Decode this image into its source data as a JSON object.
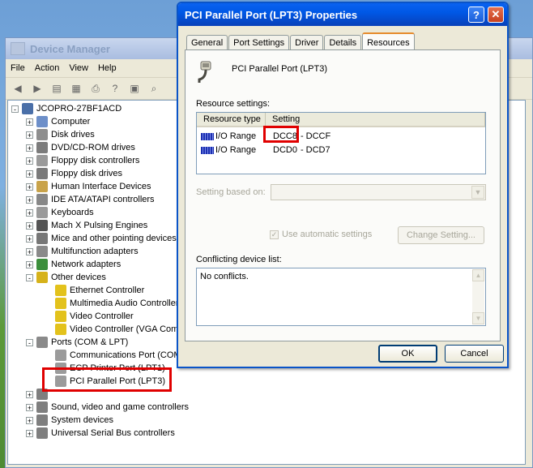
{
  "device_manager": {
    "title": "Device Manager",
    "menu": [
      "File",
      "Action",
      "View",
      "Help"
    ],
    "toolbar_icons": [
      "back-arrow-icon",
      "forward-arrow-icon",
      "show-hide-tree-icon",
      "properties-icon",
      "print-icon",
      "help-icon",
      "view-icon",
      "scan-icon"
    ],
    "tree": {
      "root": "JCOPRO-27BF1ACD",
      "categories": [
        {
          "label": "Computer",
          "expander": "+"
        },
        {
          "label": "Disk drives",
          "expander": "+"
        },
        {
          "label": "DVD/CD-ROM drives",
          "expander": "+"
        },
        {
          "label": "Floppy disk controllers",
          "expander": "+"
        },
        {
          "label": "Floppy disk drives",
          "expander": "+"
        },
        {
          "label": "Human Interface Devices",
          "expander": "+"
        },
        {
          "label": "IDE ATA/ATAPI controllers",
          "expander": "+"
        },
        {
          "label": "Keyboards",
          "expander": "+"
        },
        {
          "label": "Mach X Pulsing Engines",
          "expander": "+"
        },
        {
          "label": "Mice and other pointing devices",
          "expander": "+"
        },
        {
          "label": "Multifunction adapters",
          "expander": "+"
        },
        {
          "label": "Network adapters",
          "expander": "+"
        },
        {
          "label": "Other devices",
          "expander": "-"
        }
      ],
      "other_devices": [
        "Ethernet Controller",
        "Multimedia Audio Controller",
        "Video Controller",
        "Video Controller (VGA Comp"
      ],
      "ports_label": "Ports (COM & LPT)",
      "ports_expander": "-",
      "ports": [
        "Communications Port (COM",
        "ECP Printer Port (LPT1)",
        "PCI Parallel Port (LPT3)"
      ],
      "tail_categories": [
        {
          "label": "",
          "expander": "+"
        },
        {
          "label": "Sound, video and game controllers",
          "expander": "+"
        },
        {
          "label": "System devices",
          "expander": "+"
        },
        {
          "label": "Universal Serial Bus controllers",
          "expander": "+"
        }
      ]
    }
  },
  "dialog": {
    "title": "PCI Parallel Port (LPT3) Properties",
    "help_glyph": "?",
    "close_glyph": "✕",
    "tabs": [
      "General",
      "Port Settings",
      "Driver",
      "Details",
      "Resources"
    ],
    "active_tab": "Resources",
    "device_name": "PCI Parallel Port (LPT3)",
    "resource_settings_label": "Resource settings:",
    "columns": [
      "Resource type",
      "Setting"
    ],
    "resources": [
      {
        "type": "I/O Range",
        "setting_start": "DCC8",
        "setting_rest": "- DCCF"
      },
      {
        "type": "I/O Range",
        "setting_start": "DCD0",
        "setting_rest": "- DCD7"
      }
    ],
    "setting_based_on_label": "Setting based on:",
    "use_automatic_label": "Use automatic settings",
    "use_automatic_checked": true,
    "change_setting_label": "Change Setting...",
    "conflict_label": "Conflicting device list:",
    "conflict_text": "No conflicts.",
    "ok_label": "OK",
    "cancel_label": "Cancel"
  },
  "colors": {
    "title_blue": "#0058e6",
    "highlight_red": "#e00000",
    "tab_accent": "#e68b2c"
  }
}
